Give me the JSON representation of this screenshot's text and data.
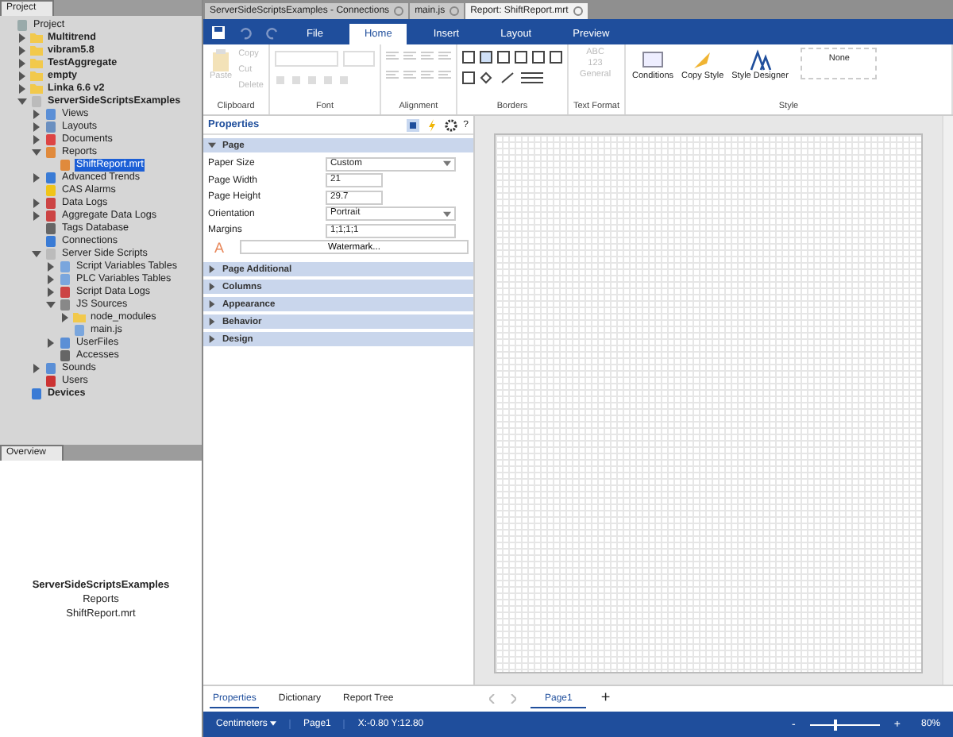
{
  "project_panel": {
    "title": "Project",
    "tree": [
      {
        "label": "Project",
        "kind": "project",
        "selected": false,
        "children": [
          {
            "label": "Multitrend",
            "kind": "folder",
            "expanded": false,
            "selected": false
          },
          {
            "label": "vibram5.8",
            "kind": "folder",
            "expanded": false,
            "selected": false
          },
          {
            "label": "TestAggregate",
            "kind": "folder",
            "expanded": false,
            "selected": false
          },
          {
            "label": "empty",
            "kind": "folder",
            "expanded": false,
            "selected": false
          },
          {
            "label": "Linka 6.6 v2",
            "kind": "folder",
            "expanded": false,
            "selected": false
          },
          {
            "label": "ServerSideScriptsExamples",
            "kind": "file",
            "expanded": true,
            "selected": false,
            "children": [
              {
                "label": "Views",
                "kind": "views",
                "expanded": false,
                "selected": false
              },
              {
                "label": "Layouts",
                "kind": "layouts",
                "expanded": false,
                "selected": false
              },
              {
                "label": "Documents",
                "kind": "documents",
                "expanded": false,
                "selected": false
              },
              {
                "label": "Reports",
                "kind": "reports",
                "expanded": true,
                "selected": false,
                "children": [
                  {
                    "label": "ShiftReport.mrt",
                    "kind": "reports",
                    "selected": true
                  }
                ]
              },
              {
                "label": "Advanced Trends",
                "kind": "trends",
                "expanded": false,
                "selected": false
              },
              {
                "label": "CAS Alarms",
                "kind": "alarms",
                "selected": false
              },
              {
                "label": "Data Logs",
                "kind": "logs",
                "expanded": false,
                "selected": false
              },
              {
                "label": "Aggregate Data Logs",
                "kind": "logs",
                "expanded": false,
                "selected": false
              },
              {
                "label": "Tags Database",
                "kind": "database",
                "selected": false
              },
              {
                "label": "Connections",
                "kind": "trends",
                "selected": false
              },
              {
                "label": "Server Side Scripts",
                "kind": "file",
                "expanded": true,
                "selected": false,
                "children": [
                  {
                    "label": "Script Variables Tables",
                    "kind": "table",
                    "expanded": false,
                    "selected": false
                  },
                  {
                    "label": "PLC Variables Tables",
                    "kind": "table",
                    "expanded": false,
                    "selected": false
                  },
                  {
                    "label": "Script Data Logs",
                    "kind": "logs",
                    "expanded": false,
                    "selected": false
                  },
                  {
                    "label": "JS Sources",
                    "kind": "js",
                    "expanded": true,
                    "selected": false,
                    "children": [
                      {
                        "label": "node_modules",
                        "kind": "folder",
                        "expanded": false,
                        "selected": false
                      },
                      {
                        "label": "main.js",
                        "kind": "table",
                        "selected": false
                      }
                    ]
                  },
                  {
                    "label": "UserFiles",
                    "kind": "views",
                    "expanded": false,
                    "selected": false
                  },
                  {
                    "label": "Accesses",
                    "kind": "database",
                    "selected": false
                  }
                ]
              },
              {
                "label": "Sounds",
                "kind": "views",
                "expanded": false,
                "selected": false
              },
              {
                "label": "Users",
                "kind": "users",
                "selected": false
              }
            ]
          },
          {
            "label": "Devices",
            "kind": "trends",
            "selected": false
          }
        ]
      }
    ]
  },
  "overview": {
    "title": "Overview",
    "lines": [
      "ServerSideScriptsExamples",
      "Reports",
      "ShiftReport.mrt"
    ]
  },
  "doc_tabs": [
    {
      "label": "ServerSideScriptsExamples - Connections",
      "selected": false
    },
    {
      "label": "main.js",
      "selected": false
    },
    {
      "label": "Report: ShiftReport.mrt",
      "selected": true
    }
  ],
  "ribbon": {
    "tabs": [
      {
        "label": "File",
        "selected": false
      },
      {
        "label": "Home",
        "selected": true
      },
      {
        "label": "Insert",
        "selected": false
      },
      {
        "label": "Layout",
        "selected": false
      },
      {
        "label": "Preview",
        "selected": false
      }
    ],
    "groups": [
      {
        "kind": "clipboard",
        "label": "Clipboard",
        "buttons": [
          {
            "label": "Paste",
            "disabled": true
          },
          {
            "label": "Copy",
            "disabled": true
          },
          {
            "label": "Cut",
            "disabled": true
          },
          {
            "label": "Delete",
            "disabled": true
          }
        ]
      },
      {
        "kind": "font",
        "label": "Font"
      },
      {
        "kind": "alignment",
        "label": "Alignment"
      },
      {
        "kind": "borders",
        "label": "Borders"
      },
      {
        "kind": "text_format",
        "label": "Text Format",
        "lines": [
          "ABC",
          "123"
        ],
        "button": {
          "label": "General",
          "disabled": true
        }
      },
      {
        "kind": "style",
        "label": "Style",
        "buttons": [
          {
            "label": "Conditions"
          },
          {
            "label": "Copy Style"
          },
          {
            "label": "Style Designer"
          }
        ],
        "style_box": "None"
      }
    ]
  },
  "properties": {
    "title": "Properties",
    "help": "?",
    "sections": [
      {
        "label": "Page",
        "expanded": true,
        "fields": [
          {
            "label": "Paper Size",
            "value": "Custom",
            "kind": "dropdown"
          },
          {
            "label": "Page Width",
            "value": "21",
            "kind": "text"
          },
          {
            "label": "Page Height",
            "value": "29.7",
            "kind": "text"
          },
          {
            "label": "Orientation",
            "value": "Portrait",
            "kind": "dropdown"
          },
          {
            "label": "Margins",
            "value": "1;1;1;1",
            "kind": "wide"
          }
        ],
        "watermark_icon": "A",
        "button": "Watermark..."
      },
      {
        "label": "Page Additional",
        "expanded": false
      },
      {
        "label": "Columns",
        "expanded": false
      },
      {
        "label": "Appearance",
        "expanded": false
      },
      {
        "label": "Behavior",
        "expanded": false
      },
      {
        "label": "Design",
        "expanded": false
      }
    ]
  },
  "panel_tabs": [
    {
      "label": "Properties",
      "selected": true
    },
    {
      "label": "Dictionary",
      "selected": false
    },
    {
      "label": "Report Tree",
      "selected": false
    }
  ],
  "page_tabs": [
    {
      "label": "Page1",
      "selected": true
    }
  ],
  "add_page": "+",
  "status_bar": {
    "units": "Centimeters",
    "page": "Page1",
    "position": "X:-0.80 Y:12.80",
    "zoom_out": "-",
    "zoom_in": "+",
    "zoom": {
      "level": 0.35
    },
    "zoom_reading": "80%"
  }
}
